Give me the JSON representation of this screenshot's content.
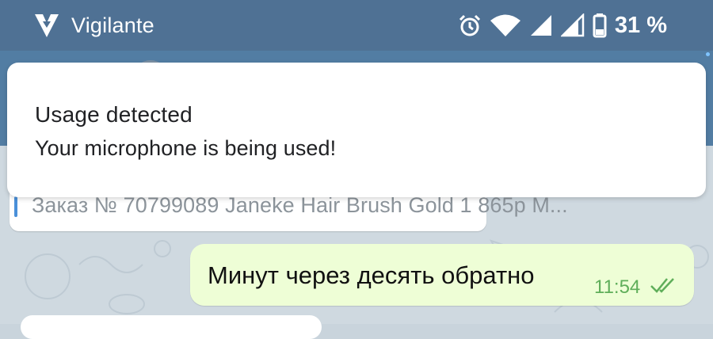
{
  "status_bar": {
    "app_name": "Vigilante",
    "battery_percent": "31 %",
    "icons": [
      "app-logo-icon",
      "alarm-icon",
      "wifi-icon",
      "signal-icon",
      "signal-icon-2",
      "battery-icon"
    ]
  },
  "notification": {
    "title": "Usage detected",
    "body": "Your microphone is being used!"
  },
  "chat": {
    "quoted_message": "Заказ № 70799089 Janeke Hair Brush Gold 1 865р М...",
    "outgoing_message": {
      "text": "Минут через десять обратно",
      "time": "11:54",
      "status_icon": "double-check-icon"
    }
  },
  "colors": {
    "status_bar": "#4f7194",
    "header": "#527da3",
    "outgoing_bubble": "#eefed6",
    "time_green": "#5fae5a",
    "quote_bar": "#4a90d9"
  }
}
